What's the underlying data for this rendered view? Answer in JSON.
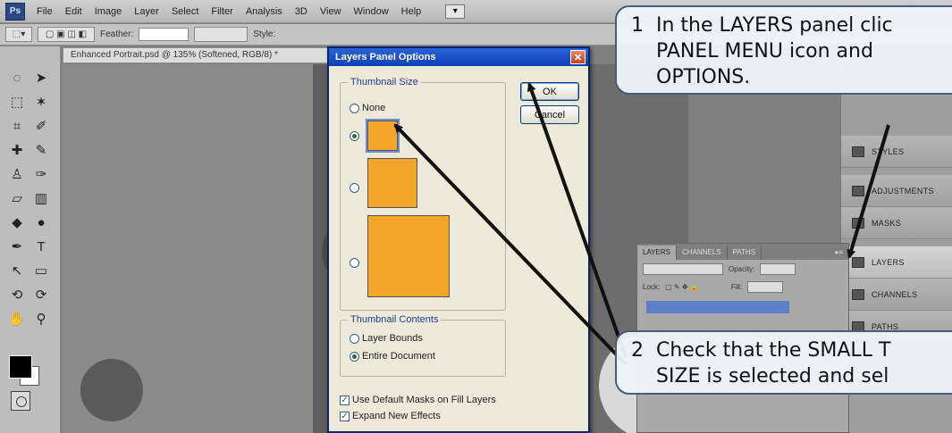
{
  "menu": {
    "logo": "Ps",
    "items": [
      "File",
      "Edit",
      "Image",
      "Layer",
      "Select",
      "Filter",
      "Analysis",
      "3D",
      "View",
      "Window",
      "Help"
    ],
    "workspace_icon": "▾"
  },
  "options_bar": {
    "feather_label": "Feather:",
    "style_label": "Style:"
  },
  "document": {
    "tab_title": "Enhanced Portrait.psd @ 135% (Softened, RGB/8) *"
  },
  "right_panels": [
    {
      "label": "STYLES",
      "icon": "styles-icon"
    },
    {
      "label": "ADJUSTMENTS",
      "icon": "adjustments-icon"
    },
    {
      "label": "MASKS",
      "icon": "masks-icon"
    },
    {
      "label": "LAYERS",
      "icon": "layers-icon"
    },
    {
      "label": "CHANNELS",
      "icon": "channels-icon"
    },
    {
      "label": "PATHS",
      "icon": "paths-icon"
    }
  ],
  "layers_panel": {
    "tabs": [
      "LAYERS",
      "CHANNELS",
      "PATHS"
    ],
    "opacity_label": "Opacity:",
    "lock_label": "Lock:",
    "fill_label": "Fill:"
  },
  "dialog": {
    "title": "Layers Panel Options",
    "thumbnail_size_label": "Thumbnail Size",
    "thumbnail_sizes": [
      "None",
      "",
      "",
      ""
    ],
    "selected_size_index": 1,
    "ok_label": "OK",
    "cancel_label": "Cancel",
    "thumbnail_contents_label": "Thumbnail Contents",
    "contents_options": [
      "Layer Bounds",
      "Entire Document"
    ],
    "selected_contents_index": 1,
    "checkboxes": [
      {
        "label": "Use Default Masks on Fill Layers",
        "checked": true
      },
      {
        "label": "Expand New Effects",
        "checked": true
      }
    ]
  },
  "callouts": [
    {
      "number": "1",
      "lines": [
        "In the LAYERS panel clic",
        "PANEL MENU icon and",
        "OPTIONS."
      ]
    },
    {
      "number": "2",
      "lines": [
        "Check that the SMALL T",
        "SIZE is selected and sel"
      ]
    }
  ],
  "colors": {
    "arrow": "#111111",
    "callout_border": "#4a5a7a",
    "dialog_title": "#0e41b8"
  }
}
